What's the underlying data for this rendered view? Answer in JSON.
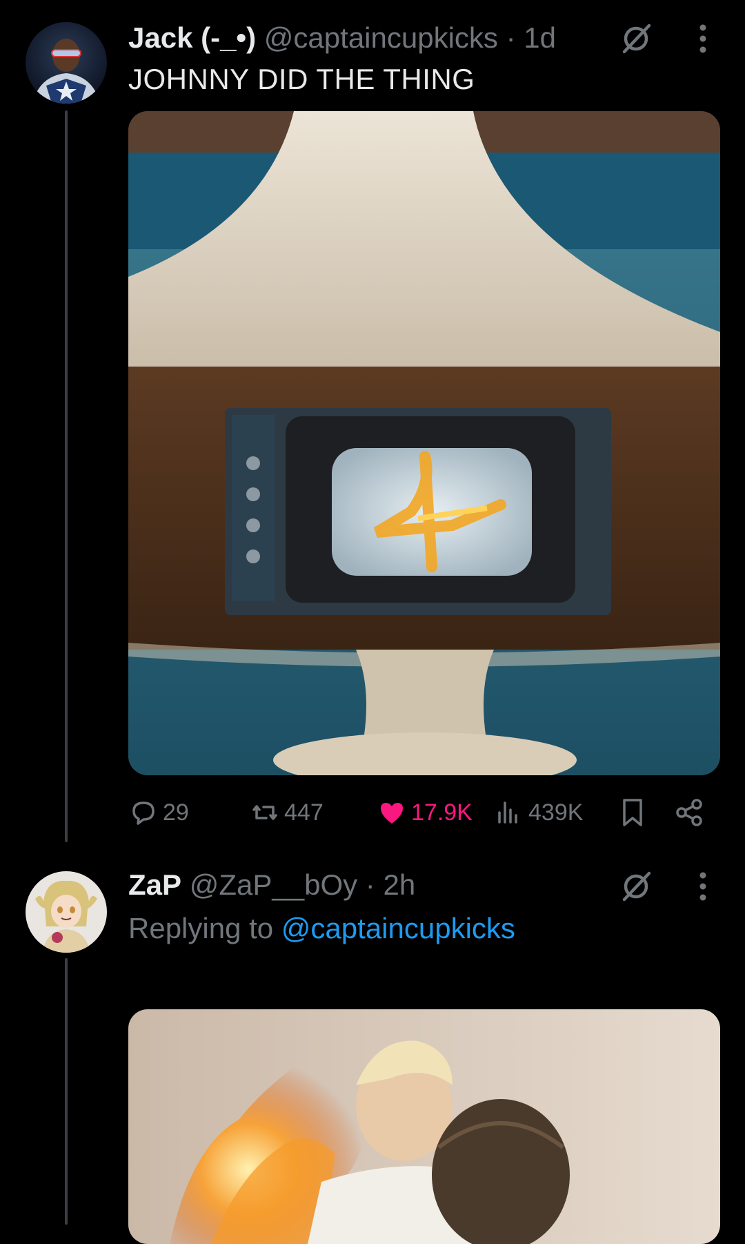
{
  "tweet1": {
    "name": "Jack (-_•)",
    "handle": "@captaincupkicks",
    "separator": "·",
    "time": "1d",
    "text": "JOHNNY DID THE THING",
    "actions": {
      "replies": "29",
      "reposts": "447",
      "likes": "17.9K",
      "views": "439K"
    }
  },
  "tweet2": {
    "name": "ZaP",
    "handle": "@ZaP__bOy",
    "separator": "·",
    "time": "2h",
    "replying_prefix": "Replying to",
    "replying_to": "@captaincupkicks"
  },
  "colors": {
    "background": "#000000",
    "text": "#e7e9ea",
    "muted": "#71767b",
    "like": "#f91880",
    "link": "#1d9bf0"
  },
  "icons": [
    "grok-icon",
    "more-icon",
    "reply-icon",
    "repost-icon",
    "like-icon",
    "views-icon",
    "bookmark-icon",
    "share-icon"
  ]
}
